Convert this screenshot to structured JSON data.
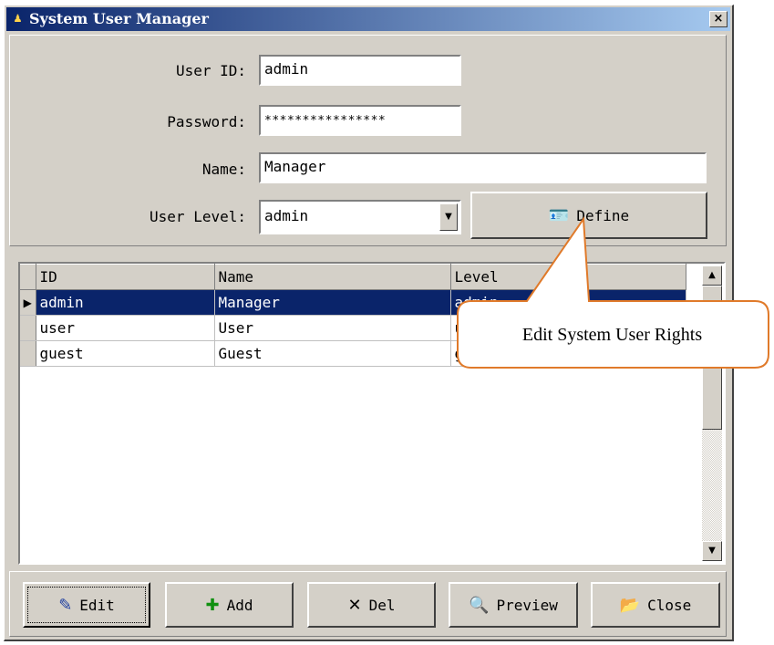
{
  "window": {
    "title": "System User Manager",
    "close_label": "×"
  },
  "form": {
    "user_id_label": "User ID:",
    "user_id_value": "admin",
    "password_label": "Password:",
    "password_value": "****************",
    "name_label": "Name:",
    "name_value": "Manager",
    "user_level_label": "User Level:",
    "user_level_value": "admin",
    "define_label": "Define"
  },
  "grid": {
    "columns": [
      "ID",
      "Name",
      "Level"
    ],
    "rows": [
      {
        "id": "admin",
        "name": "Manager",
        "level": "admin",
        "selected": true
      },
      {
        "id": "user",
        "name": "User",
        "level": "user",
        "selected": false
      },
      {
        "id": "guest",
        "name": "Guest",
        "level": "guest",
        "selected": false
      }
    ]
  },
  "callout": {
    "text": "Edit System User Rights"
  },
  "toolbar": {
    "edit_label": "Edit",
    "add_label": "Add",
    "del_label": "Del",
    "preview_label": "Preview",
    "close_label": "Close"
  },
  "icons": {
    "app": "app-icon",
    "define": "id-card-icon",
    "edit": "edit-icon",
    "add": "plus-icon",
    "del": "x-icon",
    "preview": "preview-icon",
    "close": "folder-open-icon"
  },
  "colors": {
    "title_bar_start": "#0a246a",
    "title_bar_end": "#a6caf0",
    "selection": "#0a246a",
    "face": "#d4d0c8",
    "callout_border": "#e07a2a",
    "add_icon": "#109010"
  }
}
